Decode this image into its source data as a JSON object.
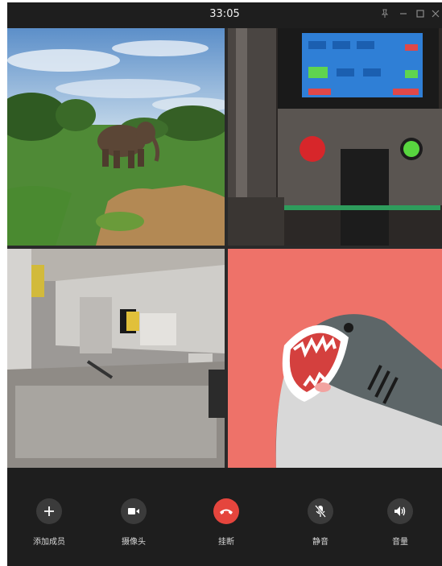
{
  "titlebar": {
    "timer": "33:05",
    "pin_icon": "pin-icon",
    "minimize_icon": "minimize-icon",
    "maximize_icon": "maximize-icon",
    "close_icon": "close-icon"
  },
  "participants": [
    {
      "content": "elephant-savanna-video"
    },
    {
      "content": "machine-control-panel-video"
    },
    {
      "content": "machine-steel-parts-video"
    },
    {
      "content": "shark-cartoon-avatar"
    }
  ],
  "controls": [
    {
      "label": "添加成员",
      "icon": "plus-icon"
    },
    {
      "label": "摄像头",
      "icon": "camera-icon"
    },
    {
      "label": "挂断",
      "icon": "hangup-icon"
    },
    {
      "label": "静音",
      "icon": "mic-muted-icon"
    },
    {
      "label": "音量",
      "icon": "speaker-icon"
    }
  ],
  "colors": {
    "background": "#1e1e1e",
    "button": "#3b3b3b",
    "hangup": "#e5453d",
    "shark_bg": "#ee7269"
  }
}
